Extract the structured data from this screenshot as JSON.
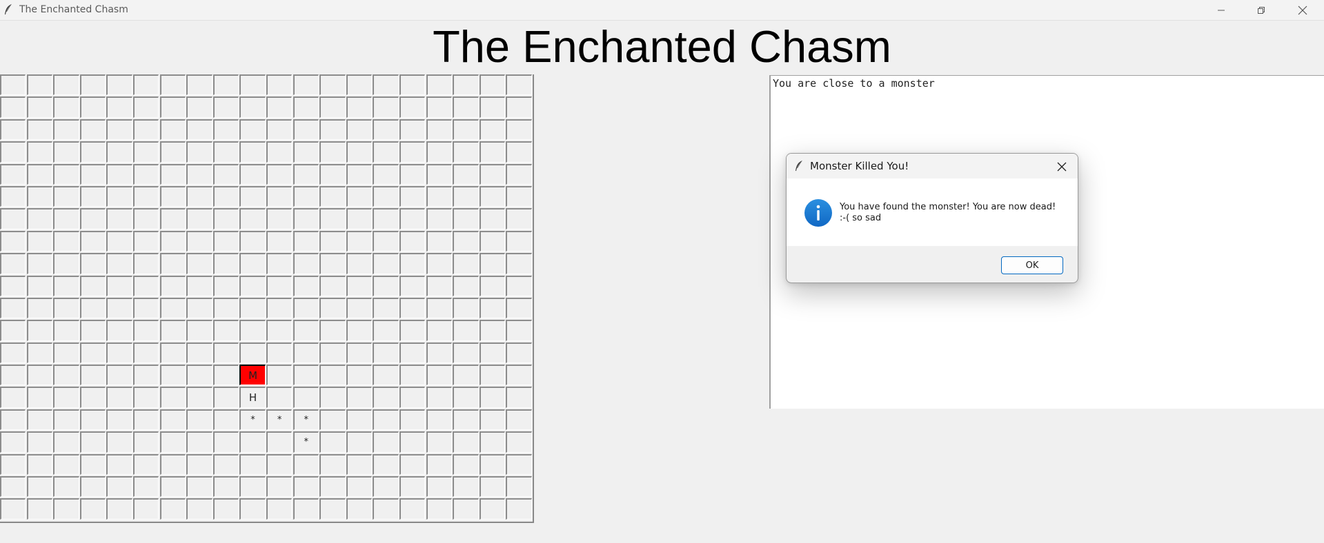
{
  "window": {
    "title": "The Enchanted Chasm",
    "icon": "feather-icon"
  },
  "heading": "The Enchanted Chasm",
  "grid": {
    "rows": 20,
    "cols": 20,
    "cells": [
      {
        "row": 13,
        "col": 9,
        "text": "M",
        "kind": "monster"
      },
      {
        "row": 14,
        "col": 9,
        "text": "H",
        "kind": "hero"
      },
      {
        "row": 15,
        "col": 9,
        "text": "*",
        "kind": "star"
      },
      {
        "row": 15,
        "col": 10,
        "text": "*",
        "kind": "star"
      },
      {
        "row": 15,
        "col": 11,
        "text": "*",
        "kind": "star"
      },
      {
        "row": 16,
        "col": 11,
        "text": "*",
        "kind": "star"
      }
    ],
    "monster_color": "#ff0000"
  },
  "log": {
    "text": "You are close to a monster"
  },
  "dialog": {
    "title": "Monster Killed You!",
    "message": "You have found the monster! You are now dead!\n :-( so sad",
    "ok_label": "OK",
    "icon": "info-icon",
    "accent": "#0067c0"
  }
}
